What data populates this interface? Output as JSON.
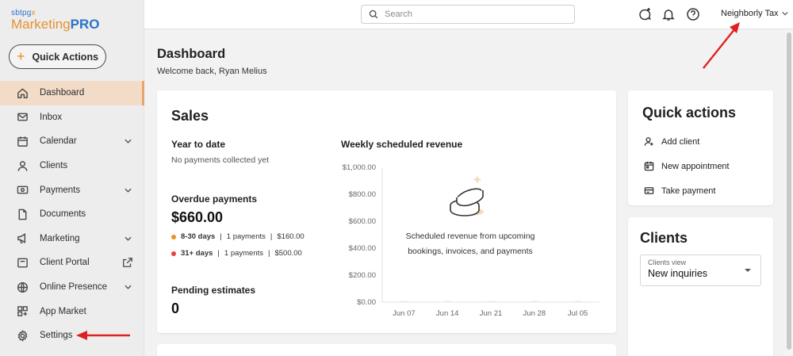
{
  "brand": {
    "small": "sbtpg",
    "small_mark": "x",
    "name_a": "Marketing",
    "name_b": "PRO"
  },
  "sidebar": {
    "quick_actions_label": "Quick Actions",
    "items": [
      {
        "label": "Dashboard",
        "icon": "home-icon"
      },
      {
        "label": "Inbox",
        "icon": "mail-icon"
      },
      {
        "label": "Calendar",
        "icon": "calendar-icon"
      },
      {
        "label": "Clients",
        "icon": "person-icon"
      },
      {
        "label": "Payments",
        "icon": "payment-icon"
      },
      {
        "label": "Documents",
        "icon": "document-icon"
      },
      {
        "label": "Marketing",
        "icon": "megaphone-icon"
      },
      {
        "label": "Client Portal",
        "icon": "portal-icon"
      },
      {
        "label": "Online Presence",
        "icon": "globe-icon"
      },
      {
        "label": "App Market",
        "icon": "apps-icon"
      },
      {
        "label": "Settings",
        "icon": "gear-icon"
      }
    ]
  },
  "topbar": {
    "search_placeholder": "Search",
    "org_name": "Neighborly Tax"
  },
  "page": {
    "title": "Dashboard",
    "welcome": "Welcome back, Ryan Melius"
  },
  "sales": {
    "title": "Sales",
    "ytd_label": "Year to date",
    "ytd_value": "No payments collected yet",
    "overdue_label": "Overdue payments",
    "overdue_total": "$660.00",
    "overdue_rows": [
      {
        "range": "8-30 days",
        "count": "1 payments",
        "amount": "$160.00",
        "color": "#f0901f"
      },
      {
        "range": "31+ days",
        "count": "1 payments",
        "amount": "$500.00",
        "color": "#e0463a"
      }
    ],
    "pending_label": "Pending estimates",
    "pending_value": "0",
    "sep": "|"
  },
  "chart_data": {
    "type": "bar",
    "title": "Weekly scheduled revenue",
    "categories": [
      "Jun 07",
      "Jun 14",
      "Jun 21",
      "Jun 28",
      "Jul 05"
    ],
    "values": [
      0,
      0,
      0,
      0,
      0
    ],
    "yticks": [
      "$0.00",
      "$200.00",
      "$400.00",
      "$600.00",
      "$800.00",
      "$1,000.00"
    ],
    "ylim": [
      0,
      1000
    ],
    "empty_message": "Scheduled revenue from upcoming bookings, invoices, and payments"
  },
  "quick_actions": {
    "title": "Quick actions",
    "items": [
      {
        "label": "Add client",
        "icon": "add-person-icon"
      },
      {
        "label": "New appointment",
        "icon": "calendar-icon"
      },
      {
        "label": "Take payment",
        "icon": "payment-icon"
      }
    ]
  },
  "clients": {
    "title": "Clients",
    "view_label": "Clients view",
    "view_value": "New inquiries"
  },
  "colors": {
    "accent": "#e8902c",
    "brand_blue": "#2a73c9",
    "active_bg": "#f3dcc7",
    "arrow": "#e02020"
  }
}
